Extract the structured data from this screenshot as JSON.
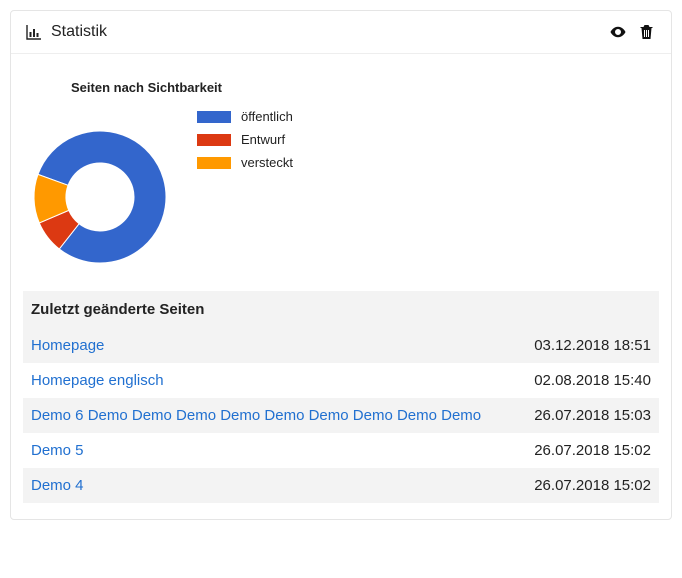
{
  "header": {
    "title": "Statistik"
  },
  "chart_data": {
    "type": "pie",
    "title": "Seiten nach Sichtbarkeit",
    "series": [
      {
        "name": "öffentlich",
        "value": 80,
        "color": "#3366cc"
      },
      {
        "name": "Entwurf",
        "value": 8,
        "color": "#dc3912"
      },
      {
        "name": "versteckt",
        "value": 12,
        "color": "#ff9900"
      }
    ]
  },
  "table": {
    "title": "Zuletzt geänderte Seiten",
    "rows": [
      {
        "name": "Homepage",
        "date": "03.12.2018 18:51"
      },
      {
        "name": "Homepage englisch",
        "date": "02.08.2018 15:40"
      },
      {
        "name": "Demo 6 Demo Demo Demo Demo Demo Demo Demo Demo Demo",
        "date": "26.07.2018 15:03"
      },
      {
        "name": "Demo 5",
        "date": "26.07.2018 15:02"
      },
      {
        "name": "Demo 4",
        "date": "26.07.2018 15:02"
      }
    ]
  }
}
